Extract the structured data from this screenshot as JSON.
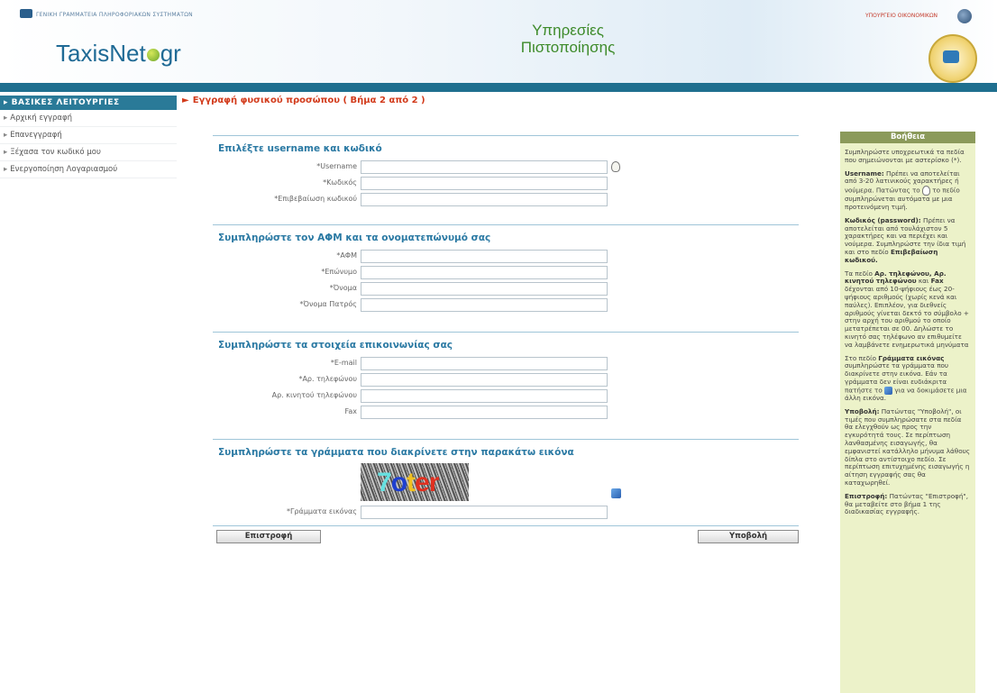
{
  "header": {
    "ministry_text": "ΓΕΝΙΚΗ ΓΡΑΜΜΑΤΕΙΑ ΠΛΗΡΟΦΟΡΙΑΚΩΝ ΣΥΣΤΗΜΑΤΩΝ",
    "logo_main": "TaxisNet",
    "logo_suffix": "gr",
    "title_line1": "Υπηρεσίες",
    "title_line2": "Πιστοποίησης",
    "top_right_link": "ΥΠΟΥΡΓΕΙΟ ΟΙΚΟΝΟΜΙΚΩΝ"
  },
  "sidebar": {
    "heading": "ΒΑΣΙΚΕΣ ΛΕΙΤΟΥΡΓΙΕΣ",
    "items": [
      {
        "label": "Αρχική εγγραφή"
      },
      {
        "label": "Επανεγγραφή"
      },
      {
        "label": "Ξέχασα τον κωδικό μου"
      },
      {
        "label": "Ενεργοποίηση Λογαριασμού"
      }
    ]
  },
  "page": {
    "heading": "Εγγραφή φυσικού προσώπου ( Βήμα 2 από 2 )"
  },
  "form": {
    "credentials": {
      "title": "Επιλέξτε username και κωδικό",
      "fields": [
        {
          "label": "*Username",
          "value": ""
        },
        {
          "label": "*Κωδικός",
          "value": ""
        },
        {
          "label": "*Επιβεβαίωση κωδικού",
          "value": ""
        }
      ]
    },
    "identity": {
      "title": "Συμπληρώστε τον ΑΦΜ και τα ονοματεπώνυμό σας",
      "fields": [
        {
          "label": "*ΑΦΜ",
          "value": ""
        },
        {
          "label": "*Επώνυμο",
          "value": ""
        },
        {
          "label": "*Όνομα",
          "value": ""
        },
        {
          "label": "*Όνομα Πατρός",
          "value": ""
        }
      ]
    },
    "contact": {
      "title": "Συμπληρώστε τα στοιχεία επικοινωνίας σας",
      "fields": [
        {
          "label": "*E-mail",
          "value": ""
        },
        {
          "label": "*Αρ. τηλεφώνου",
          "value": ""
        },
        {
          "label": "Αρ. κινητού τηλεφώνου",
          "value": ""
        },
        {
          "label": "Fax",
          "value": ""
        }
      ]
    },
    "captcha": {
      "title": "Συμπληρώστε τα γράμματα που διακρίνετε στην παρακάτω εικόνα",
      "image_chars": [
        "7",
        "o",
        "t",
        "e",
        "r"
      ],
      "field_label": "*Γράμματα εικόνας",
      "value": ""
    },
    "buttons": {
      "back": "Επιστροφή",
      "submit": "Υποβολή"
    }
  },
  "help": {
    "heading": "Βοήθεια",
    "p1": "Συμπληρώστε υποχρεωτικά τα πεδία που σημειώνονται με αστερίσκο (*).",
    "p2_bold": "Username:",
    "p2": "Πρέπει να αποτελείται από 3-20 λατινικούς χαρακτήρες ή νούμερα. Πατώντας το",
    "p2_tail": "το πεδίο συμπληρώνεται αυτόματα με μια προτεινόμενη τιμή.",
    "p3_bold": "Κωδικός (password):",
    "p3": "Πρέπει να αποτελείται από τουλάχιστον 5 χαρακτήρες και να περιέχει και νούμερα. Συμπληρώστε την ίδια τιμή και στο πεδίο",
    "p3_tail": "Επιβεβαίωση κωδικού.",
    "p4_a": "Τα πεδίο",
    "p4_b": "Αρ. τηλεφώνου, Αρ. κινητού τηλεφώνου",
    "p4_c": "και",
    "p4_d": "Fax",
    "p4_e": "δέχονται από 10-ψήφιους έως 20-ψήφιους αριθμούς (χωρίς κενά και παύλες). Επιπλέον, για διεθνείς αριθμούς γίνεται δεκτό το σύμβολο + στην αρχή του αριθμού το οποίο μετατρέπεται σε 00. Δηλώστε το κινητό σας τηλέφωνο αν επιθυμείτε να λαμβάνετε ενημερωτικά μηνύματα",
    "p5_a": "Στο πεδίο",
    "p5_b": "Γράμματα εικόνας",
    "p5_c": "συμπληρώστε τα γράμματα που διακρίνετε στην εικόνα. Εάν τα γράμματα δεν είναι ευδιάκριτα πατήστε το",
    "p5_d": "για να δοκιμάσετε μια άλλη εικόνα.",
    "p6_bold": "Υποβολή:",
    "p6": "Πατώντας \"Υποβολή\", οι τιμές που συμπληρώσατε στα πεδία θα ελεγχθούν ως προς την εγκυρότητά τους. Σε περίπτωση λανθασμένης εισαγωγής, θα εμφανιστεί κατάλληλο μήνυμα λάθους δίπλα στο αντίστοιχο πεδίο. Σε περίπτωση επιτυχημένης εισαγωγής η αίτηση εγγραφής σας θα καταχωρηθεί.",
    "p7_bold": "Επιστροφή:",
    "p7": "Πατώντας \"Επιστροφή\", θα μεταβείτε στο βήμα 1 της διαδικασίας εγγραφής."
  }
}
